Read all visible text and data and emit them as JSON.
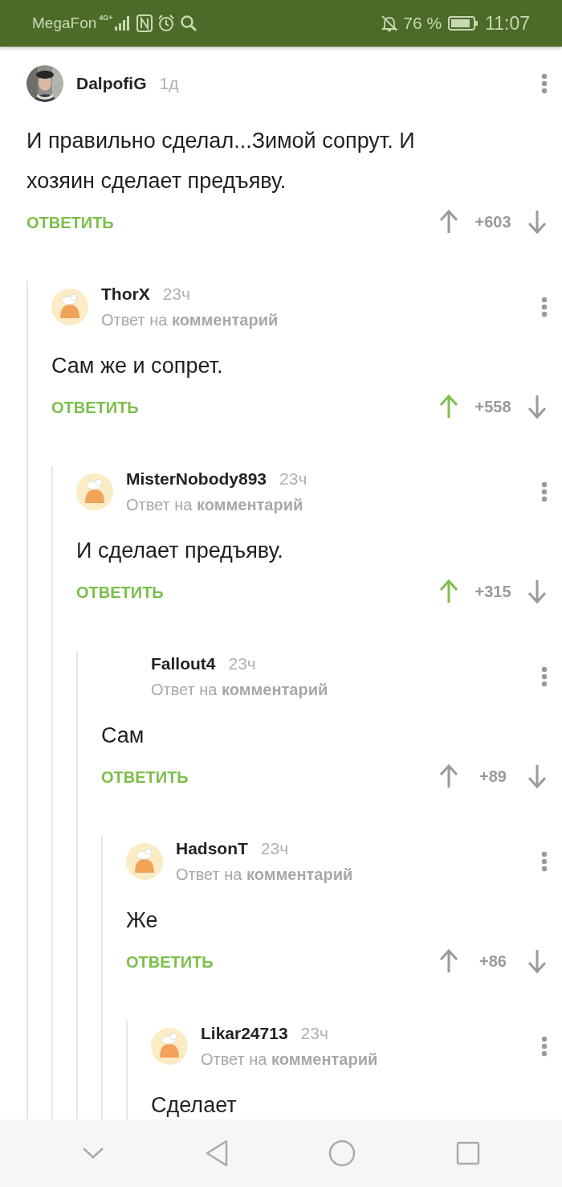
{
  "status_bar": {
    "carrier": "MegaFon",
    "network": "4G+",
    "battery_percent": "76 %",
    "time": "11:07"
  },
  "comments": [
    {
      "author": "DalpofiG",
      "time": "1д",
      "text": "И правильно сделал...Зимой сопрут. И хозяин сделает предъяву.",
      "reply_label": "ОТВЕТИТЬ",
      "score": "+603",
      "upvoted": false,
      "children": [
        {
          "author": "ThorX",
          "time": "23ч",
          "avatar": {
            "kind": "default"
          },
          "reply_to": "Ответ на **комментарий**",
          "text": "Сам же и сопрет.",
          "reply_label": "ОТВЕТИТЬ",
          "score": "+558",
          "upvoted": true,
          "children": [
            {
              "author": "MisterNobody893",
              "time": "23ч",
              "avatar": {
                "kind": "default"
              },
              "reply_to": "Ответ на **комментарий**",
              "text": "И сделает предъяву.",
              "reply_label": "ОТВЕТИТЬ",
              "score": "+315",
              "upvoted": true,
              "children": [
                {
                  "author": "Fallout4",
                  "time": "23ч",
                  "reply_to": "Ответ на **комментарий**",
                  "text": "Сам",
                  "reply_label": "ОТВЕТИТЬ",
                  "score": "+89",
                  "upvoted": false,
                  "children": [
                    {
                      "author": "HadsonT",
                      "time": "23ч",
                      "avatar": {
                        "kind": "default"
                      },
                      "reply_to": "Ответ на **комментарий**",
                      "text": "Же",
                      "reply_label": "ОТВЕТИТЬ",
                      "score": "+86",
                      "upvoted": false,
                      "children": [
                        {
                          "author": "Likar24713",
                          "time": "23ч",
                          "avatar": {
                            "kind": "default"
                          },
                          "reply_to": "Ответ на **комментарий**",
                          "text": "Сделает"
                        }
                      ]
                    }
                  ]
                }
              ]
            }
          ]
        }
      ]
    }
  ]
}
